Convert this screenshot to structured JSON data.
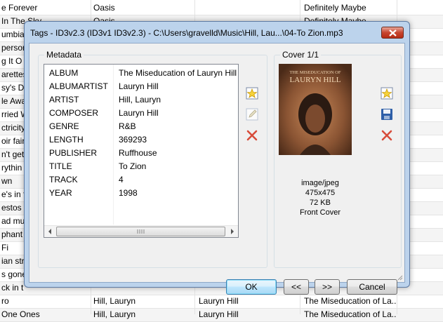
{
  "background_list": {
    "rows": [
      {
        "title": "e Forever",
        "artist": "Oasis",
        "album_artist": "",
        "album": "Definitely Maybe"
      },
      {
        "title": "In The Sky",
        "artist": "Oasis",
        "album_artist": "",
        "album": "Definitely Maybe"
      },
      {
        "title": "umbia",
        "artist": "",
        "album_artist": "",
        "album": ""
      },
      {
        "title": "personi",
        "artist": "",
        "album_artist": "",
        "album": ""
      },
      {
        "title": "g It O",
        "artist": "",
        "album_artist": "",
        "album": ""
      },
      {
        "title": "arettes",
        "artist": "",
        "album_artist": "",
        "album": ""
      },
      {
        "title": "sy's Di",
        "artist": "",
        "album_artist": "",
        "album": ""
      },
      {
        "title": "le Awa",
        "artist": "",
        "album_artist": "",
        "album": ""
      },
      {
        "title": "rried W",
        "artist": "",
        "album_artist": "",
        "album": ""
      },
      {
        "title": "ctricity",
        "artist": "",
        "album_artist": "",
        "album": ""
      },
      {
        "title": "oir fair",
        "artist": "",
        "album_artist": "",
        "album": ""
      },
      {
        "title": "n't get",
        "artist": "",
        "album_artist": "",
        "album": ""
      },
      {
        "title": "rythin",
        "artist": "",
        "album_artist": "",
        "album": ""
      },
      {
        "title": "wn",
        "artist": "",
        "album_artist": "",
        "album": ""
      },
      {
        "title": "e's in fa",
        "artist": "",
        "album_artist": "",
        "album": ""
      },
      {
        "title": "estos",
        "artist": "",
        "album_artist": "",
        "album": ""
      },
      {
        "title": "ad mus",
        "artist": "",
        "album_artist": "",
        "album": ""
      },
      {
        "title": "phant r",
        "artist": "",
        "album_artist": "",
        "album": ""
      },
      {
        "title": "Fi",
        "artist": "",
        "album_artist": "",
        "album": ""
      },
      {
        "title": "ian stri",
        "artist": "",
        "album_artist": "",
        "album": ""
      },
      {
        "title": "s gone",
        "artist": "",
        "album_artist": "",
        "album": ""
      },
      {
        "title": "ck in t",
        "artist": "",
        "album_artist": "",
        "album": ""
      },
      {
        "title": "ro",
        "artist": "Hill, Lauryn",
        "album_artist": "Lauryn Hill",
        "album": "The Miseducation of La..."
      },
      {
        "title": "One Ones",
        "artist": "Hill, Lauryn",
        "album_artist": "Lauryn Hill",
        "album": "The Miseducation of La..."
      }
    ]
  },
  "dialog": {
    "title": "Tags - ID3v2.3 (ID3v1 ID3v2.3) - C:\\Users\\gravelld\\Music\\Hill, Lau...\\04-To Zion.mp3",
    "metadata_label": "Metadata",
    "cover_label": "Cover 1/1",
    "fields": [
      {
        "key": "ALBUM",
        "value": "The Miseducation of Lauryn Hill"
      },
      {
        "key": "ALBUMARTIST",
        "value": "Lauryn Hill"
      },
      {
        "key": "ARTIST",
        "value": "Hill, Lauryn"
      },
      {
        "key": "COMPOSER",
        "value": "Lauryn Hill"
      },
      {
        "key": "GENRE",
        "value": "R&B"
      },
      {
        "key": "LENGTH",
        "value": "369293"
      },
      {
        "key": "PUBLISHER",
        "value": "Ruffhouse"
      },
      {
        "key": "TITLE",
        "value": "To Zion"
      },
      {
        "key": "TRACK",
        "value": "4"
      },
      {
        "key": "YEAR",
        "value": "1998"
      }
    ],
    "cover": {
      "album_art_text_top": "THE MISEDUCATION OF",
      "album_art_text_name": "LAURYN HILL",
      "mime": "image/jpeg",
      "dimensions": "475x475",
      "size": "72 KB",
      "type": "Front Cover"
    },
    "buttons": {
      "ok": "OK",
      "prev": "<<",
      "next": ">>",
      "cancel": "Cancel"
    }
  },
  "colors": {
    "accent": "#3c7fb1",
    "close": "#c7452e",
    "title_bar": "#bcd3ec"
  }
}
